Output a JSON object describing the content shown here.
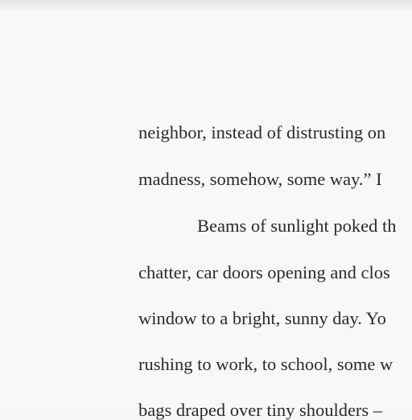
{
  "document": {
    "lines": [
      "neighbor, instead of distrusting on",
      "madness, somehow, some way.” I",
      "Beams of sunlight poked th",
      "chatter, car doors opening and clos",
      "window to a bright, sunny day. Yo",
      "rushing to work, to school, some w",
      "bags draped over tiny shoulders –"
    ]
  }
}
